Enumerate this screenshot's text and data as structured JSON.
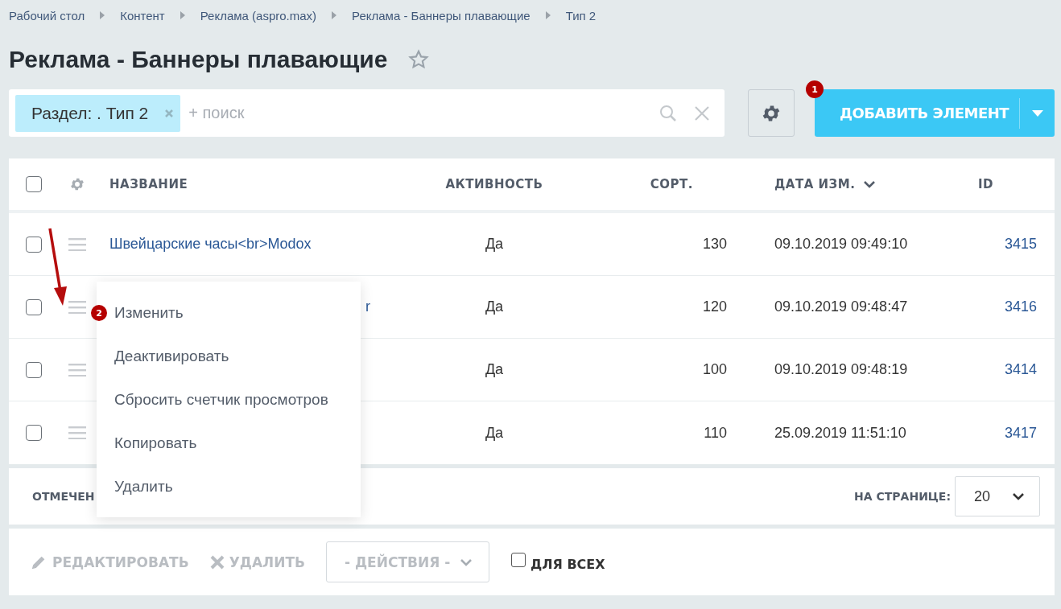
{
  "breadcrumbs": [
    "Рабочий стол",
    "Контент",
    "Реклама (aspro.max)",
    "Реклама - Баннеры плавающие",
    "Тип 2"
  ],
  "title": "Реклама - Баннеры плавающие",
  "filter": {
    "tag": "Раздел: . Тип 2",
    "placeholder": "+ поиск"
  },
  "add_button": {
    "label": "ДОБАВИТЬ ЭЛЕМЕНТ",
    "badge": "1"
  },
  "table": {
    "select_all": {
      "checked": false
    },
    "columns": [
      {
        "label": "НАЗВАНИЕ",
        "sorted": false
      },
      {
        "label": "АКТИВНОСТЬ",
        "sorted": false
      },
      {
        "label": "СОРТ.",
        "sorted": false
      },
      {
        "label": "ДАТА ИЗМ.",
        "sorted": true
      },
      {
        "label": "ID",
        "sorted": false
      }
    ],
    "rows": [
      {
        "checked": false,
        "name": "Швейцарские часы<br>Modox",
        "covered": false,
        "active": "Да",
        "sort": "130",
        "date": "09.10.2019 09:49:10",
        "id": "3415"
      },
      {
        "checked": false,
        "name": "r",
        "covered": true,
        "active": "Да",
        "sort": "120",
        "date": "09.10.2019 09:48:47",
        "id": "3416"
      },
      {
        "checked": false,
        "active": "Да",
        "sort": "100",
        "date": "09.10.2019 09:48:19",
        "id": "3414"
      },
      {
        "checked": false,
        "active": "Да",
        "sort": "110",
        "date": "25.09.2019 11:51:10",
        "id": "3417"
      }
    ]
  },
  "context_menu": {
    "badge": "2",
    "items": [
      "Изменить",
      "Деактивировать",
      "Сбросить счетчик просмотров",
      "Копировать",
      "Удалить"
    ]
  },
  "footer": {
    "selected_label": "ОТМЕЧЕН",
    "per_page_label": "НА СТРАНИЦЕ:",
    "per_page": "20"
  },
  "actions": {
    "buttons": [
      {
        "kind": "edit",
        "label": "РЕДАКТИРОВАТЬ",
        "disabled": true
      },
      {
        "kind": "delete",
        "label": "УДАЛИТЬ",
        "disabled": true
      }
    ],
    "select": "- ДЕЙСТВИЯ -",
    "for_all": {
      "label": "ДЛЯ ВСЕХ",
      "checked": false
    }
  }
}
